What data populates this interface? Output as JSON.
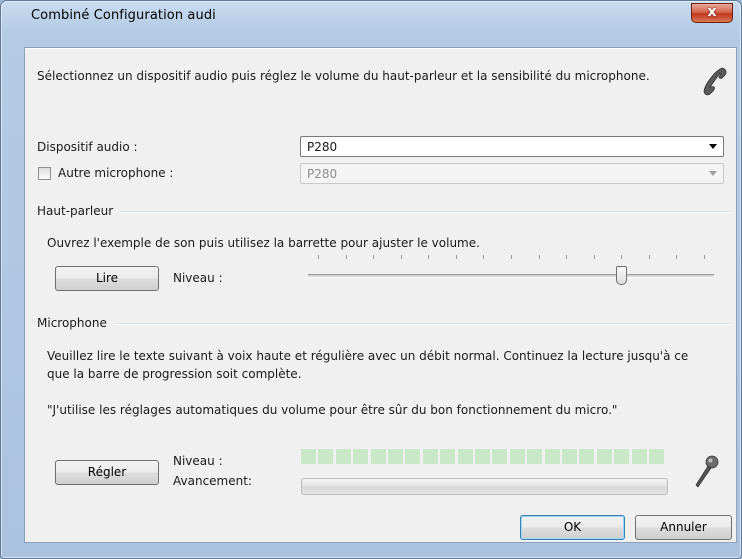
{
  "window": {
    "title": "Combiné Configuration audi",
    "close_label": "x"
  },
  "intro": "Sélectionnez un dispositif audio puis réglez le volume du haut-parleur et la sensibilité du microphone.",
  "device": {
    "label": "Dispositif audio :",
    "value": "P280"
  },
  "alt_mic": {
    "label": "Autre microphone :",
    "checked": false,
    "value": "P280"
  },
  "speaker": {
    "group_label": "Haut-parleur",
    "instructions": "Ouvrez l'exemple de son puis utilisez la barrette pour ajuster le volume.",
    "play_button": "Lire",
    "level_label": "Niveau :",
    "level_fraction": 0.78
  },
  "microphone": {
    "group_label": "Microphone",
    "instructions_line1": "Veuillez lire le texte suivant à voix haute et régulière avec un débit normal. Continuez la lecture jusqu'à ce",
    "instructions_line2": "que la barre de progression soit complète.",
    "quote": "\"J'utilise les réglages automatiques du volume pour être sûr du bon fonctionnement du micro.\"",
    "adjust_button": "Régler",
    "level_label": "Niveau :",
    "progress_label": "Avancement:",
    "progress_fraction": 0.0
  },
  "buttons": {
    "ok": "OK",
    "cancel": "Annuler"
  },
  "colors": {
    "accent": "#3c7fb1",
    "level_meter": "#c8e8c8",
    "close": "#c1361d"
  },
  "icons": {
    "phone": "phone-handset-icon",
    "mic": "microphone-icon"
  }
}
